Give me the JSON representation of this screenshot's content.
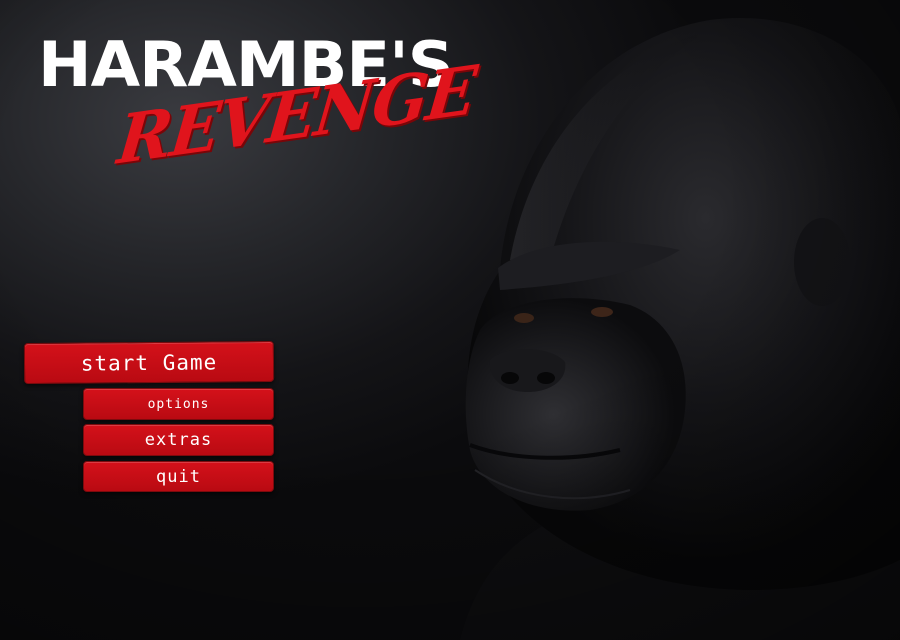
{
  "game": {
    "title_line1": "HARAMBE'S",
    "title_line2": "REVENGE"
  },
  "menu": {
    "start_label": "start Game",
    "options_label": "options",
    "extras_label": "extras",
    "quit_label": "quit"
  },
  "colors": {
    "accent_red": "#d4111a",
    "title_white": "#ffffff",
    "background": "#0b0b0d"
  },
  "icons": {
    "hero_art": "gorilla-portrait"
  }
}
